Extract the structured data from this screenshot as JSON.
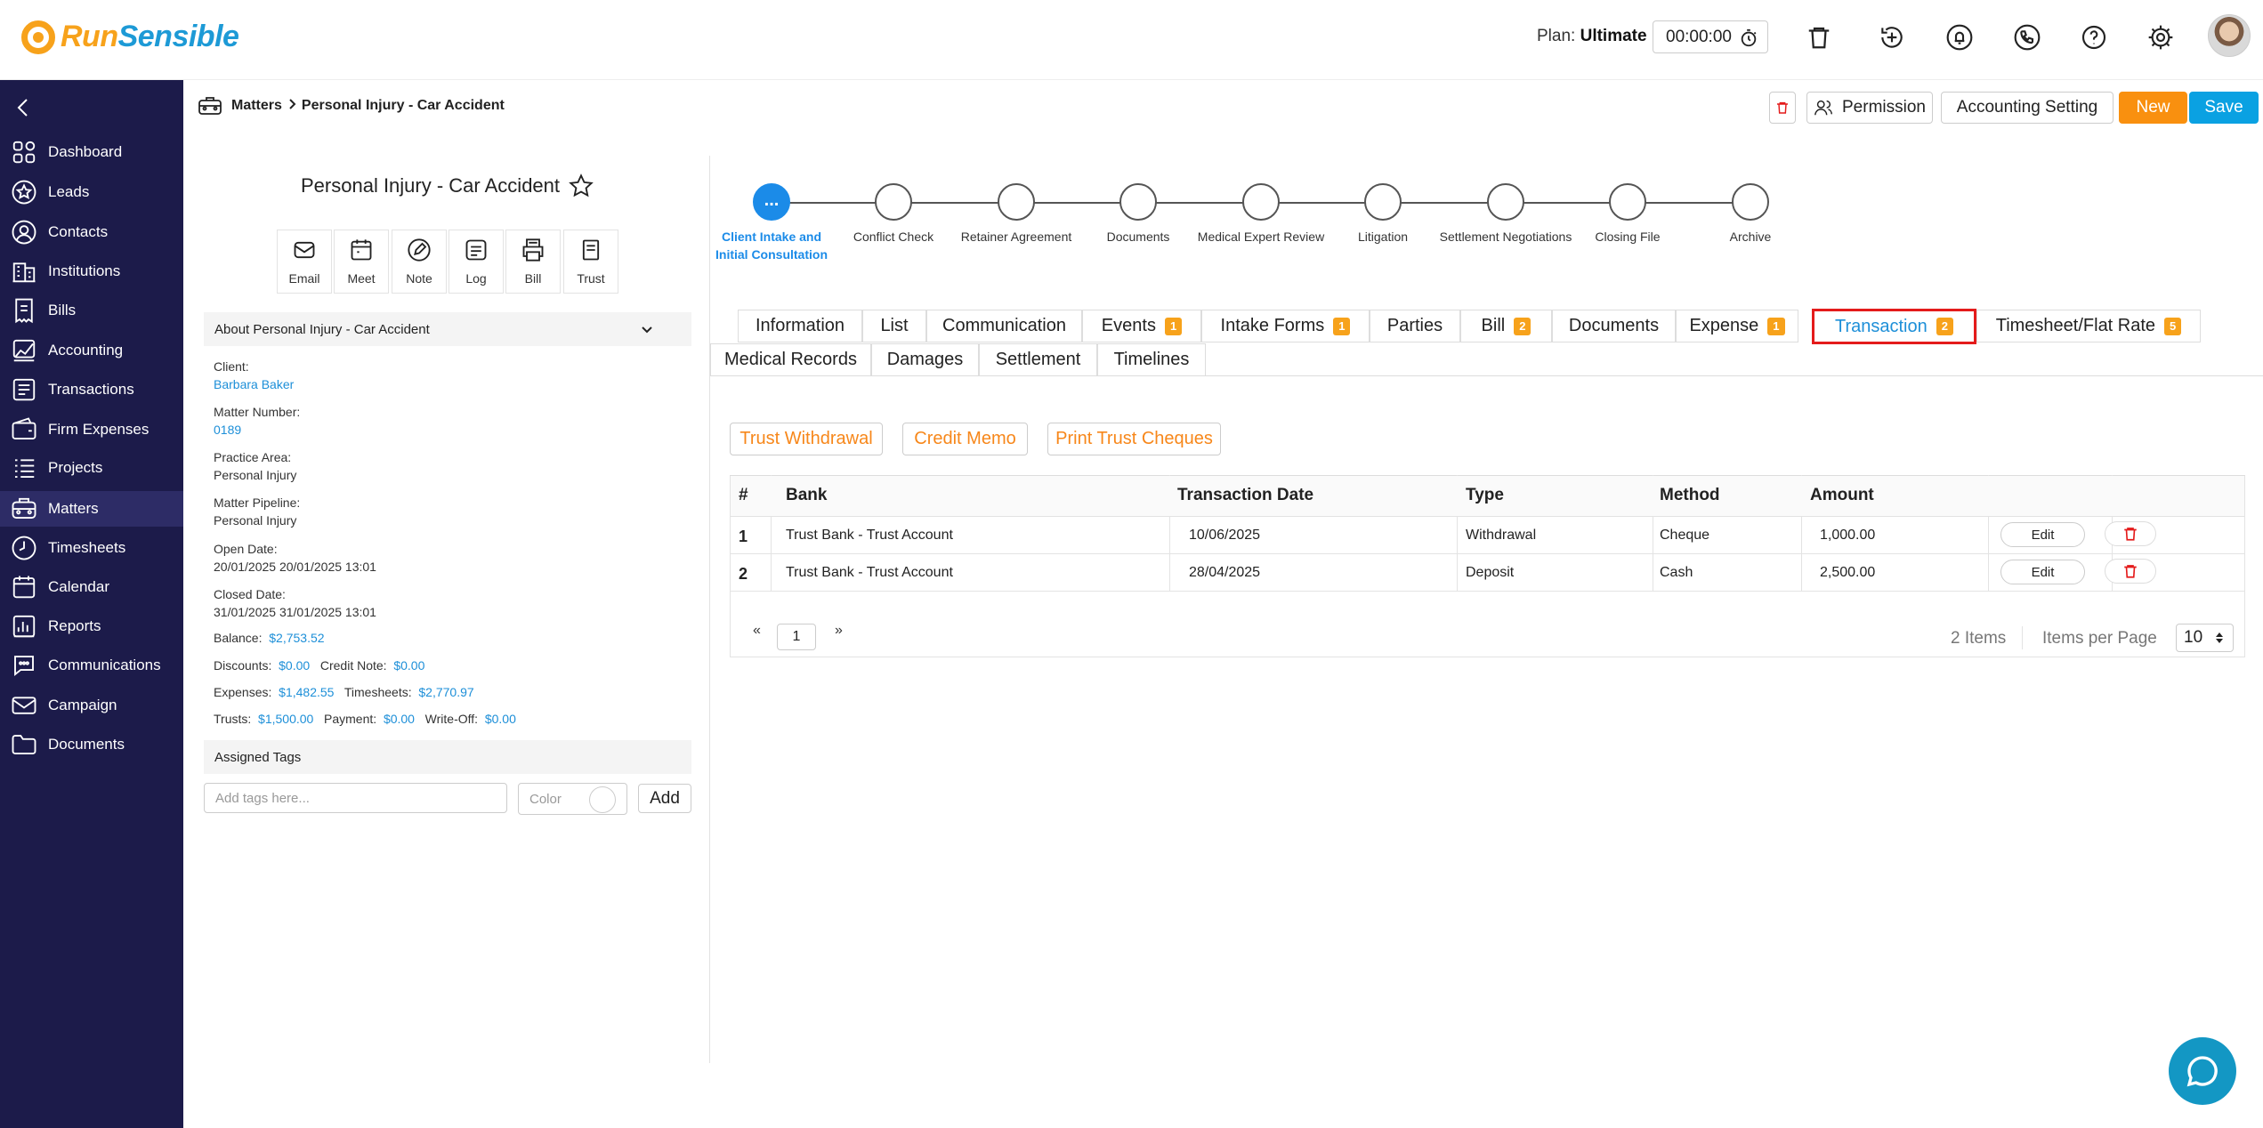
{
  "brand": {
    "part1": "Run",
    "part2": "Sensible"
  },
  "header": {
    "plan_label": "Plan:",
    "plan_value": "Ultimate",
    "timer": "00:00:00"
  },
  "sidebar": {
    "items": [
      {
        "label": "Dashboard",
        "icon": "dashboard-icon"
      },
      {
        "label": "Leads",
        "icon": "star-icon"
      },
      {
        "label": "Contacts",
        "icon": "user-circle-icon"
      },
      {
        "label": "Institutions",
        "icon": "building-icon"
      },
      {
        "label": "Bills",
        "icon": "receipt-icon"
      },
      {
        "label": "Accounting",
        "icon": "chart-icon"
      },
      {
        "label": "Transactions",
        "icon": "list-icon"
      },
      {
        "label": "Firm Expenses",
        "icon": "wallet-icon"
      },
      {
        "label": "Projects",
        "icon": "tasks-icon"
      },
      {
        "label": "Matters",
        "icon": "briefcase-icon"
      },
      {
        "label": "Timesheets",
        "icon": "clock-icon"
      },
      {
        "label": "Calendar",
        "icon": "calendar-icon"
      },
      {
        "label": "Reports",
        "icon": "report-icon"
      },
      {
        "label": "Communications",
        "icon": "chat-icon"
      },
      {
        "label": "Campaign",
        "icon": "mail-icon"
      },
      {
        "label": "Documents",
        "icon": "folder-icon"
      }
    ]
  },
  "breadcrumb": {
    "root": "Matters",
    "current": "Personal Injury - Car Accident"
  },
  "actions": {
    "permission": "Permission",
    "accounting_setting": "Accounting Setting",
    "new": "New",
    "save": "Save"
  },
  "matter": {
    "title": "Personal Injury - Car Accident",
    "quick_actions": [
      "Email",
      "Meet",
      "Note",
      "Log",
      "Bill",
      "Trust"
    ],
    "about_title": "About Personal Injury - Car Accident",
    "fields": {
      "client_label": "Client:",
      "client_value": "Barbara Baker",
      "matter_number_label": "Matter Number:",
      "matter_number_value": "0189",
      "practice_area_label": "Practice Area:",
      "practice_area_value": "Personal Injury",
      "pipeline_label": "Matter Pipeline:",
      "pipeline_value": "Personal Injury",
      "open_date_label": "Open Date:",
      "open_date_value": "20/01/2025 20/01/2025 13:01",
      "closed_date_label": "Closed Date:",
      "closed_date_value": "31/01/2025 31/01/2025 13:01"
    },
    "finance": {
      "balance_label": "Balance:",
      "balance": "$2,753.52",
      "discounts_label": "Discounts:",
      "discounts": "$0.00",
      "credit_note_label": "Credit Note:",
      "credit_note": "$0.00",
      "expenses_label": "Expenses:",
      "expenses": "$1,482.55",
      "timesheets_label": "Timesheets:",
      "timesheets": "$2,770.97",
      "trusts_label": "Trusts:",
      "trusts": "$1,500.00",
      "payment_label": "Payment:",
      "payment": "$0.00",
      "writeoff_label": "Write-Off:",
      "writeoff": "$0.00"
    },
    "tags_title": "Assigned Tags",
    "tags_placeholder": "Add tags here...",
    "color_placeholder": "Color",
    "add_label": "Add"
  },
  "pipeline": {
    "stages": [
      {
        "label": "Client Intake and Initial Consultation",
        "active": true,
        "dot": "..."
      },
      {
        "label": "Conflict Check"
      },
      {
        "label": "Retainer Agreement"
      },
      {
        "label": "Documents"
      },
      {
        "label": "Medical Expert Review"
      },
      {
        "label": "Litigation"
      },
      {
        "label": "Settlement Negotiations"
      },
      {
        "label": "Closing File"
      },
      {
        "label": "Archive"
      }
    ]
  },
  "tabs": {
    "row1": [
      {
        "label": "Information"
      },
      {
        "label": "List"
      },
      {
        "label": "Communication"
      },
      {
        "label": "Events",
        "badge": "1"
      },
      {
        "label": "Intake Forms",
        "badge": "1"
      },
      {
        "label": "Parties"
      },
      {
        "label": "Bill",
        "badge": "2"
      },
      {
        "label": "Documents"
      },
      {
        "label": "Expense",
        "badge": "1"
      },
      {
        "label": "Transaction",
        "badge": "2",
        "active": true
      },
      {
        "label": "Timesheet/Flat Rate",
        "badge": "5"
      }
    ],
    "row2": [
      {
        "label": "Medical Records"
      },
      {
        "label": "Damages"
      },
      {
        "label": "Settlement"
      },
      {
        "label": "Timelines"
      }
    ]
  },
  "transaction_actions": [
    "Trust Withdrawal",
    "Credit Memo",
    "Print Trust Cheques"
  ],
  "table": {
    "headers": [
      "#",
      "Bank",
      "Transaction Date",
      "Type",
      "Method",
      "Amount"
    ],
    "rows": [
      {
        "num": "1",
        "bank": "Trust Bank - Trust Account",
        "date": "10/06/2025",
        "type": "Withdrawal",
        "method": "Cheque",
        "amount": "1,000.00",
        "edit": "Edit"
      },
      {
        "num": "2",
        "bank": "Trust Bank - Trust Account",
        "date": "28/04/2025",
        "type": "Deposit",
        "method": "Cash",
        "amount": "2,500.00",
        "edit": "Edit"
      }
    ]
  },
  "pagination": {
    "prev": "«",
    "page": "1",
    "next": "»",
    "items_count": "2 Items",
    "items_per_page_label": "Items per Page",
    "items_per_page": "10"
  },
  "colors": {
    "sidebar_bg": "#1c1b4a",
    "accent_orange": "#f9900f",
    "accent_blue": "#0aa1e2",
    "active_tab_border": "#e41b1b"
  }
}
